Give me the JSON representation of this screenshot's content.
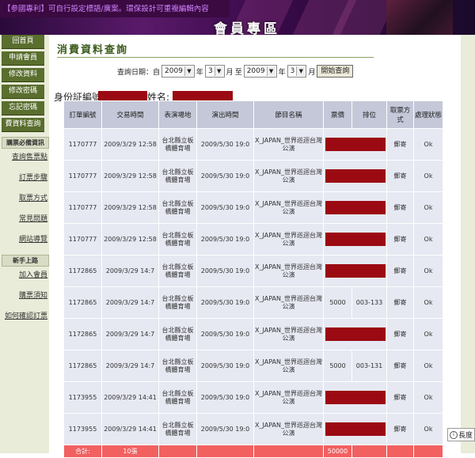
{
  "banner": {
    "top_note": "【参國專利】可自行設定標語/廣案。環保設計可重複編輯內容",
    "member_title": "會員專區"
  },
  "sidebar": {
    "nav_items": [
      {
        "label": "回首頁"
      },
      {
        "label": "申請會員"
      },
      {
        "label": "修改資料"
      },
      {
        "label": "修改密碼"
      },
      {
        "label": "忘記密碼"
      },
      {
        "label": "費資料查詢"
      }
    ],
    "section1": "購票必備資訊",
    "links1": [
      "查詢售票點",
      "訂票步驟",
      "取票方式",
      "常見問題",
      "網站導覽"
    ],
    "section2": "新手上路",
    "links2": [
      "加入會員",
      "購票須知",
      "如何確認訂票"
    ]
  },
  "page": {
    "title": "消費資料查詢",
    "query_label": "查詢日期：自",
    "start_year": "2009",
    "start_month": "3",
    "year_unit": "年",
    "month_unit": "月",
    "to_label": "至",
    "end_year": "2009",
    "end_month": "3",
    "search_button": "開始查詢",
    "id_label": "身份証編號",
    "name_label": "姓名:"
  },
  "table": {
    "headers": [
      "訂單編號",
      "交易時間",
      "表演場地",
      "演出時間",
      "節目名稱",
      "票價",
      "排位",
      "取票方式",
      "處理狀態"
    ],
    "rows": [
      {
        "order": "1170777",
        "time": "2009/3/29 12:58",
        "venue": "台北縣立板橋體育場",
        "show": "2009/5/30 19:0",
        "program": "X_JAPAN_世界巡迴台灣公演",
        "price": "",
        "seat": "",
        "pickup": "郵寄",
        "status": "Ok",
        "redacted": true
      },
      {
        "order": "1170777",
        "time": "2009/3/29 12:58",
        "venue": "台北縣立板橋體育場",
        "show": "2009/5/30 19:0",
        "program": "X_JAPAN_世界巡迴台灣公演",
        "price": "",
        "seat": "",
        "pickup": "郵寄",
        "status": "Ok",
        "redacted": true
      },
      {
        "order": "1170777",
        "time": "2009/3/29 12:58",
        "venue": "台北縣立板橋體育場",
        "show": "2009/5/30 19:0",
        "program": "X_JAPAN_世界巡迴台灣公演",
        "price": "",
        "seat": "",
        "pickup": "郵寄",
        "status": "Ok",
        "redacted": true
      },
      {
        "order": "1170777",
        "time": "2009/3/29 12:58",
        "venue": "台北縣立板橋體育場",
        "show": "2009/5/30 19:0",
        "program": "X_JAPAN_世界巡迴台灣公演",
        "price": "",
        "seat": "",
        "pickup": "郵寄",
        "status": "Ok",
        "redacted": true
      },
      {
        "order": "1172865",
        "time": "2009/3/29 14:7",
        "venue": "台北縣立板橋體育場",
        "show": "2009/5/30 19:0",
        "program": "X_JAPAN_世界巡迴台灣公演",
        "price": "",
        "seat": "",
        "pickup": "郵寄",
        "status": "Ok",
        "redacted": true
      },
      {
        "order": "1172865",
        "time": "2009/3/29 14:7",
        "venue": "台北縣立板橋體育場",
        "show": "2009/5/30 19:0",
        "program": "X_JAPAN_世界巡迴台灣公演",
        "price": "5000",
        "seat": "003-133",
        "pickup": "郵寄",
        "status": "Ok",
        "redacted": false
      },
      {
        "order": "1172865",
        "time": "2009/3/29 14:7",
        "venue": "台北縣立板橋體育場",
        "show": "2009/5/30 19:0",
        "program": "X_JAPAN_世界巡迴台灣公演",
        "price": "",
        "seat": "",
        "pickup": "郵寄",
        "status": "Ok",
        "redacted": true
      },
      {
        "order": "1172865",
        "time": "2009/3/29 14:7",
        "venue": "台北縣立板橋體育場",
        "show": "2009/5/30 19:0",
        "program": "X_JAPAN_世界巡迴台灣公演",
        "price": "5000",
        "seat": "003-131",
        "pickup": "郵寄",
        "status": "Ok",
        "redacted": false
      },
      {
        "order": "1173955",
        "time": "2009/3/29 14:41",
        "venue": "台北縣立板橋體育場",
        "show": "2009/5/30 19:0",
        "program": "X_JAPAN_世界巡迴台灣公演",
        "price": "",
        "seat": "",
        "pickup": "郵寄",
        "status": "Ok",
        "redacted": true
      },
      {
        "order": "1173955",
        "time": "2009/3/29 14:41",
        "venue": "台北縣立板橋體育場",
        "show": "2009/5/30 19:0",
        "program": "X_JAPAN_世界巡迴台灣公演",
        "price": "",
        "seat": "",
        "pickup": "郵寄",
        "status": "Ok",
        "redacted": true
      }
    ],
    "total_label": "合計:",
    "total_count": "10張",
    "total_price": "50000"
  },
  "length_label": "長度",
  "colors": {
    "accent": "#5a6e2e",
    "header": "#c4c8d8",
    "cell": "#e6e8f2",
    "total": "#f26060",
    "redaction": "#9b0a12"
  }
}
